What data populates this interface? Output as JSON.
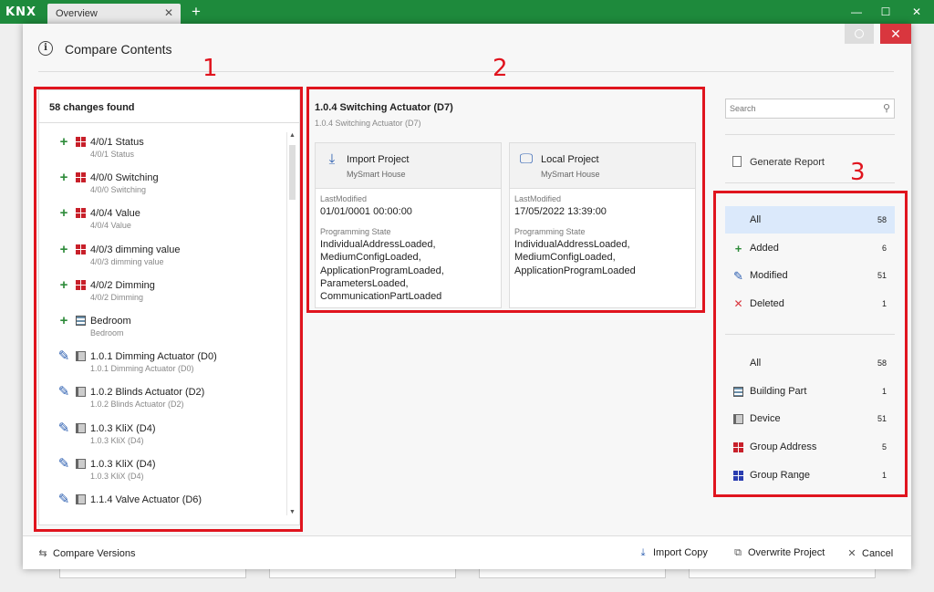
{
  "app": {
    "logo": "KNX",
    "tab_label": "Overview",
    "tab_close": "✕",
    "new_tab": "+",
    "window_controls": {
      "minimize": "—",
      "maximize": "☐",
      "close": "✕"
    }
  },
  "dialog": {
    "title": "Compare Contents",
    "close_glyph": "✕"
  },
  "annotations": [
    "1",
    "2",
    "3"
  ],
  "left_panel": {
    "heading": "58 changes found",
    "items": [
      {
        "mark": "add",
        "type": "group-address",
        "title": "4/0/1 Status",
        "subtitle": "4/0/1 Status"
      },
      {
        "mark": "add",
        "type": "group-address",
        "title": "4/0/0 Switching",
        "subtitle": "4/0/0 Switching"
      },
      {
        "mark": "add",
        "type": "group-address",
        "title": "4/0/4 Value",
        "subtitle": "4/0/4 Value"
      },
      {
        "mark": "add",
        "type": "group-address",
        "title": "4/0/3 dimming value",
        "subtitle": "4/0/3 dimming value"
      },
      {
        "mark": "add",
        "type": "group-address",
        "title": "4/0/2 Dimming",
        "subtitle": "4/0/2 Dimming"
      },
      {
        "mark": "add",
        "type": "building-part",
        "title": "Bedroom",
        "subtitle": "Bedroom"
      },
      {
        "mark": "mod",
        "type": "device",
        "title": "1.0.1 Dimming Actuator (D0)",
        "subtitle": "1.0.1 Dimming Actuator (D0)"
      },
      {
        "mark": "mod",
        "type": "device",
        "title": "1.0.2 Blinds Actuator (D2)",
        "subtitle": "1.0.2 Blinds Actuator (D2)"
      },
      {
        "mark": "mod",
        "type": "device",
        "title": "1.0.3 KliX (D4)",
        "subtitle": "1.0.3 KliX (D4)"
      },
      {
        "mark": "mod",
        "type": "device",
        "title": "1.0.3 KliX (D4)",
        "subtitle": "1.0.3 KliX (D4)"
      },
      {
        "mark": "mod",
        "type": "device",
        "title": "1.1.4 Valve Actuator (D6)",
        "subtitle": ""
      }
    ]
  },
  "detail": {
    "title": "1.0.4 Switching Actuator (D7)",
    "subtitle": "1.0.4 Switching Actuator (D7)",
    "import": {
      "name": "Import Project",
      "sub": "MySmart House",
      "last_modified_label": "LastModified",
      "last_modified": "01/01/0001 00:00:00",
      "prog_state_label": "Programming State",
      "prog_state": [
        "IndividualAddressLoaded,",
        "MediumConfigLoaded,",
        "ApplicationProgramLoaded,",
        "ParametersLoaded,",
        "CommunicationPartLoaded"
      ]
    },
    "local": {
      "name": "Local Project",
      "sub": "MySmart House",
      "last_modified_label": "LastModified",
      "last_modified": "17/05/2022 13:39:00",
      "prog_state_label": "Programming State",
      "prog_state": [
        "IndividualAddressLoaded,",
        "MediumConfigLoaded,",
        "ApplicationProgramLoaded"
      ]
    }
  },
  "right_panel": {
    "search_placeholder": "Search",
    "generate_report": "Generate Report",
    "change_filters": [
      {
        "label": "All",
        "count": "58",
        "icon": "none",
        "active": true
      },
      {
        "label": "Added",
        "count": "6",
        "icon": "plus"
      },
      {
        "label": "Modified",
        "count": "51",
        "icon": "pencil"
      },
      {
        "label": "Deleted",
        "count": "1",
        "icon": "cross"
      }
    ],
    "type_filters": [
      {
        "label": "All",
        "count": "58",
        "icon": "none"
      },
      {
        "label": "Building Part",
        "count": "1",
        "icon": "building-part"
      },
      {
        "label": "Device",
        "count": "51",
        "icon": "device"
      },
      {
        "label": "Group Address",
        "count": "5",
        "icon": "group-address"
      },
      {
        "label": "Group Range",
        "count": "1",
        "icon": "group-range"
      }
    ]
  },
  "footer": {
    "compare_versions": "Compare Versions",
    "import_copy": "Import Copy",
    "overwrite_project": "Overwrite Project",
    "cancel": "Cancel"
  },
  "colors": {
    "accent_green": "#1e8a3c",
    "annotation_red": "#e0141e",
    "added_green": "#2e8b3a",
    "modified_blue": "#2a5db0",
    "deleted_red": "#d9363e"
  }
}
